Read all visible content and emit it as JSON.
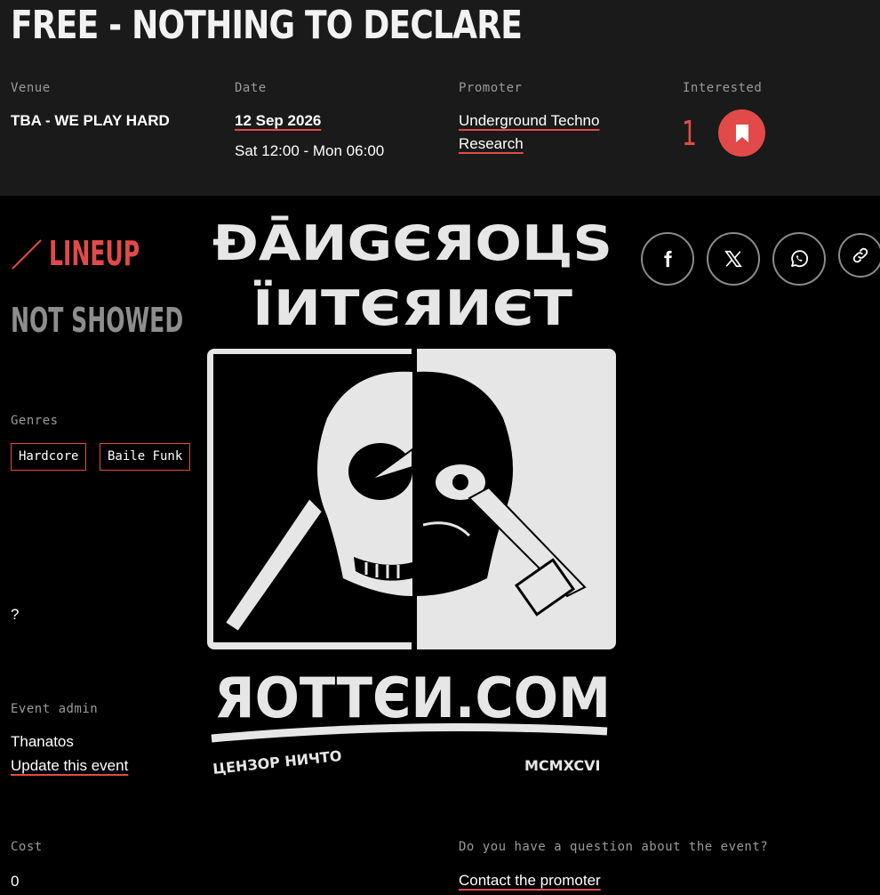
{
  "event": {
    "title": "FREE - NOTHING TO DECLARE"
  },
  "info": {
    "venue": {
      "label": "Venue",
      "value": "TBA - WE PLAY HARD"
    },
    "date": {
      "label": "Date",
      "value": "12 Sep 2026",
      "time": "Sat 12:00 - Mon 06:00"
    },
    "promoter": {
      "label": "Promoter",
      "line1": "Underground Techno",
      "line2": "Research"
    },
    "interested": {
      "label": "Interested",
      "count": "1"
    }
  },
  "lineup": {
    "title": "LINEUP",
    "status": "NOT SHOWED"
  },
  "genres": {
    "label": "Genres",
    "items": [
      "Hardcore",
      "Baile Funk"
    ]
  },
  "misc": {
    "question_mark": "?"
  },
  "admin": {
    "label": "Event admin",
    "name": "Thanatos",
    "update_link": "Update this event"
  },
  "cost": {
    "label": "Cost",
    "value": "0"
  },
  "contact": {
    "question": "Do you have a question about the event?",
    "link": "Contact the promoter"
  },
  "poster": {
    "line1": "ĐĀИGЄЯOЦS",
    "line2": "ÏИTЄЯИЄT",
    "site": "ЯOTTЄИ.COM",
    "tagline_left": "ЦЕНЗОР НИЧТО",
    "tagline_right": "MCMXCVI"
  },
  "share": {
    "icons": [
      "facebook-icon",
      "x-icon",
      "whatsapp-icon",
      "link-icon"
    ]
  },
  "colors": {
    "accent": "#e24a4a",
    "header_bg": "#1a1a1a",
    "page_bg": "#000000",
    "muted": "#9a9a9a"
  }
}
